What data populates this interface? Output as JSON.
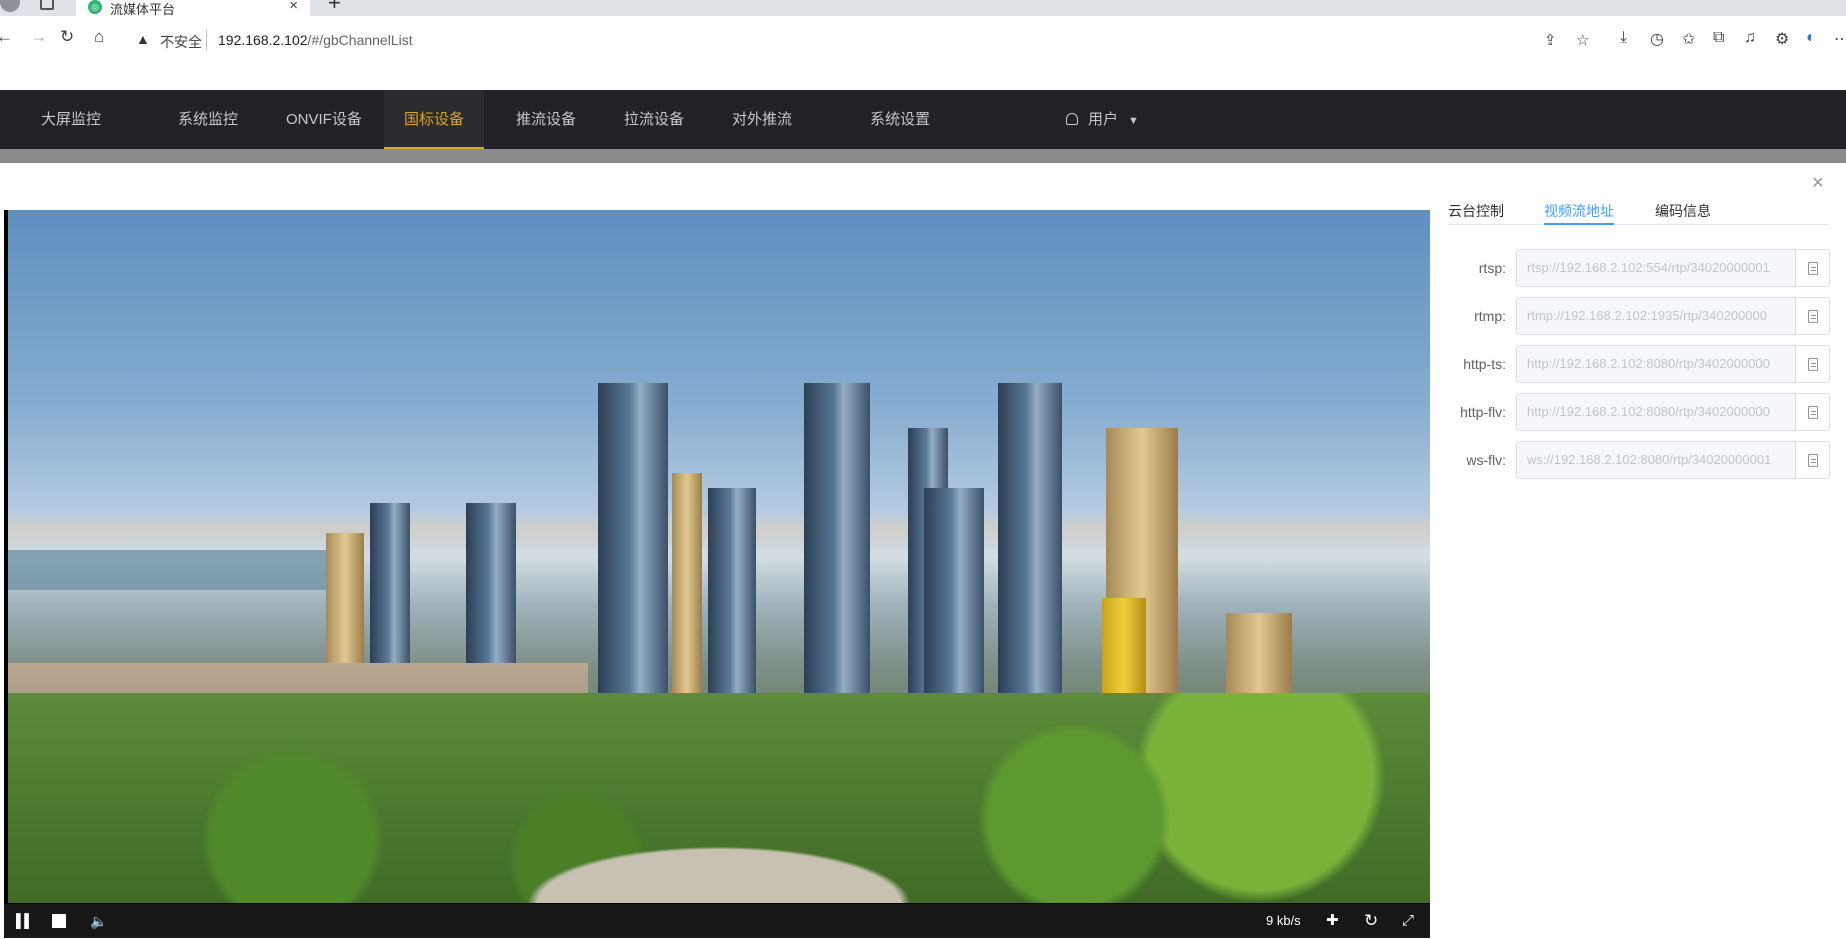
{
  "browser": {
    "tab_title": "流媒体平台",
    "tab_close": "×",
    "new_tab": "+",
    "insecure_label": "不安全",
    "url_host": "192.168.2.102",
    "url_path": "/#/gbChannelList"
  },
  "nav": {
    "items": [
      {
        "label": "大屏监控"
      },
      {
        "label": "系统监控"
      },
      {
        "label": "ONVIF设备"
      },
      {
        "label": "国标设备"
      },
      {
        "label": "推流设备"
      },
      {
        "label": "拉流设备"
      },
      {
        "label": "对外推流"
      },
      {
        "label": "系统设置"
      }
    ],
    "active": "国标设备",
    "user_label": "用户"
  },
  "dialog": {
    "close": "×",
    "tabs": [
      {
        "label": "云台控制"
      },
      {
        "label": "视频流地址"
      },
      {
        "label": "编码信息"
      }
    ],
    "active_tab": "视频流地址",
    "streams": [
      {
        "label": "rtsp:",
        "value": "rtsp://192.168.2.102:554/rtp/34020000001"
      },
      {
        "label": "rtmp:",
        "value": "rtmp://192.168.2.102:1935/rtp/340200000"
      },
      {
        "label": "http-ts:",
        "value": "http://192.168.2.102:8080/rtp/3402000000"
      },
      {
        "label": "http-flv:",
        "value": "http://192.168.2.102:8080/rtp/3402000000"
      },
      {
        "label": "ws-flv:",
        "value": "ws://192.168.2.102:8080/rtp/34020000001"
      }
    ]
  },
  "player": {
    "bitrate": "9 kb/s"
  },
  "colors": {
    "nav_bg": "#202226",
    "nav_active": "#d9a520",
    "tab_active": "#409eff"
  }
}
